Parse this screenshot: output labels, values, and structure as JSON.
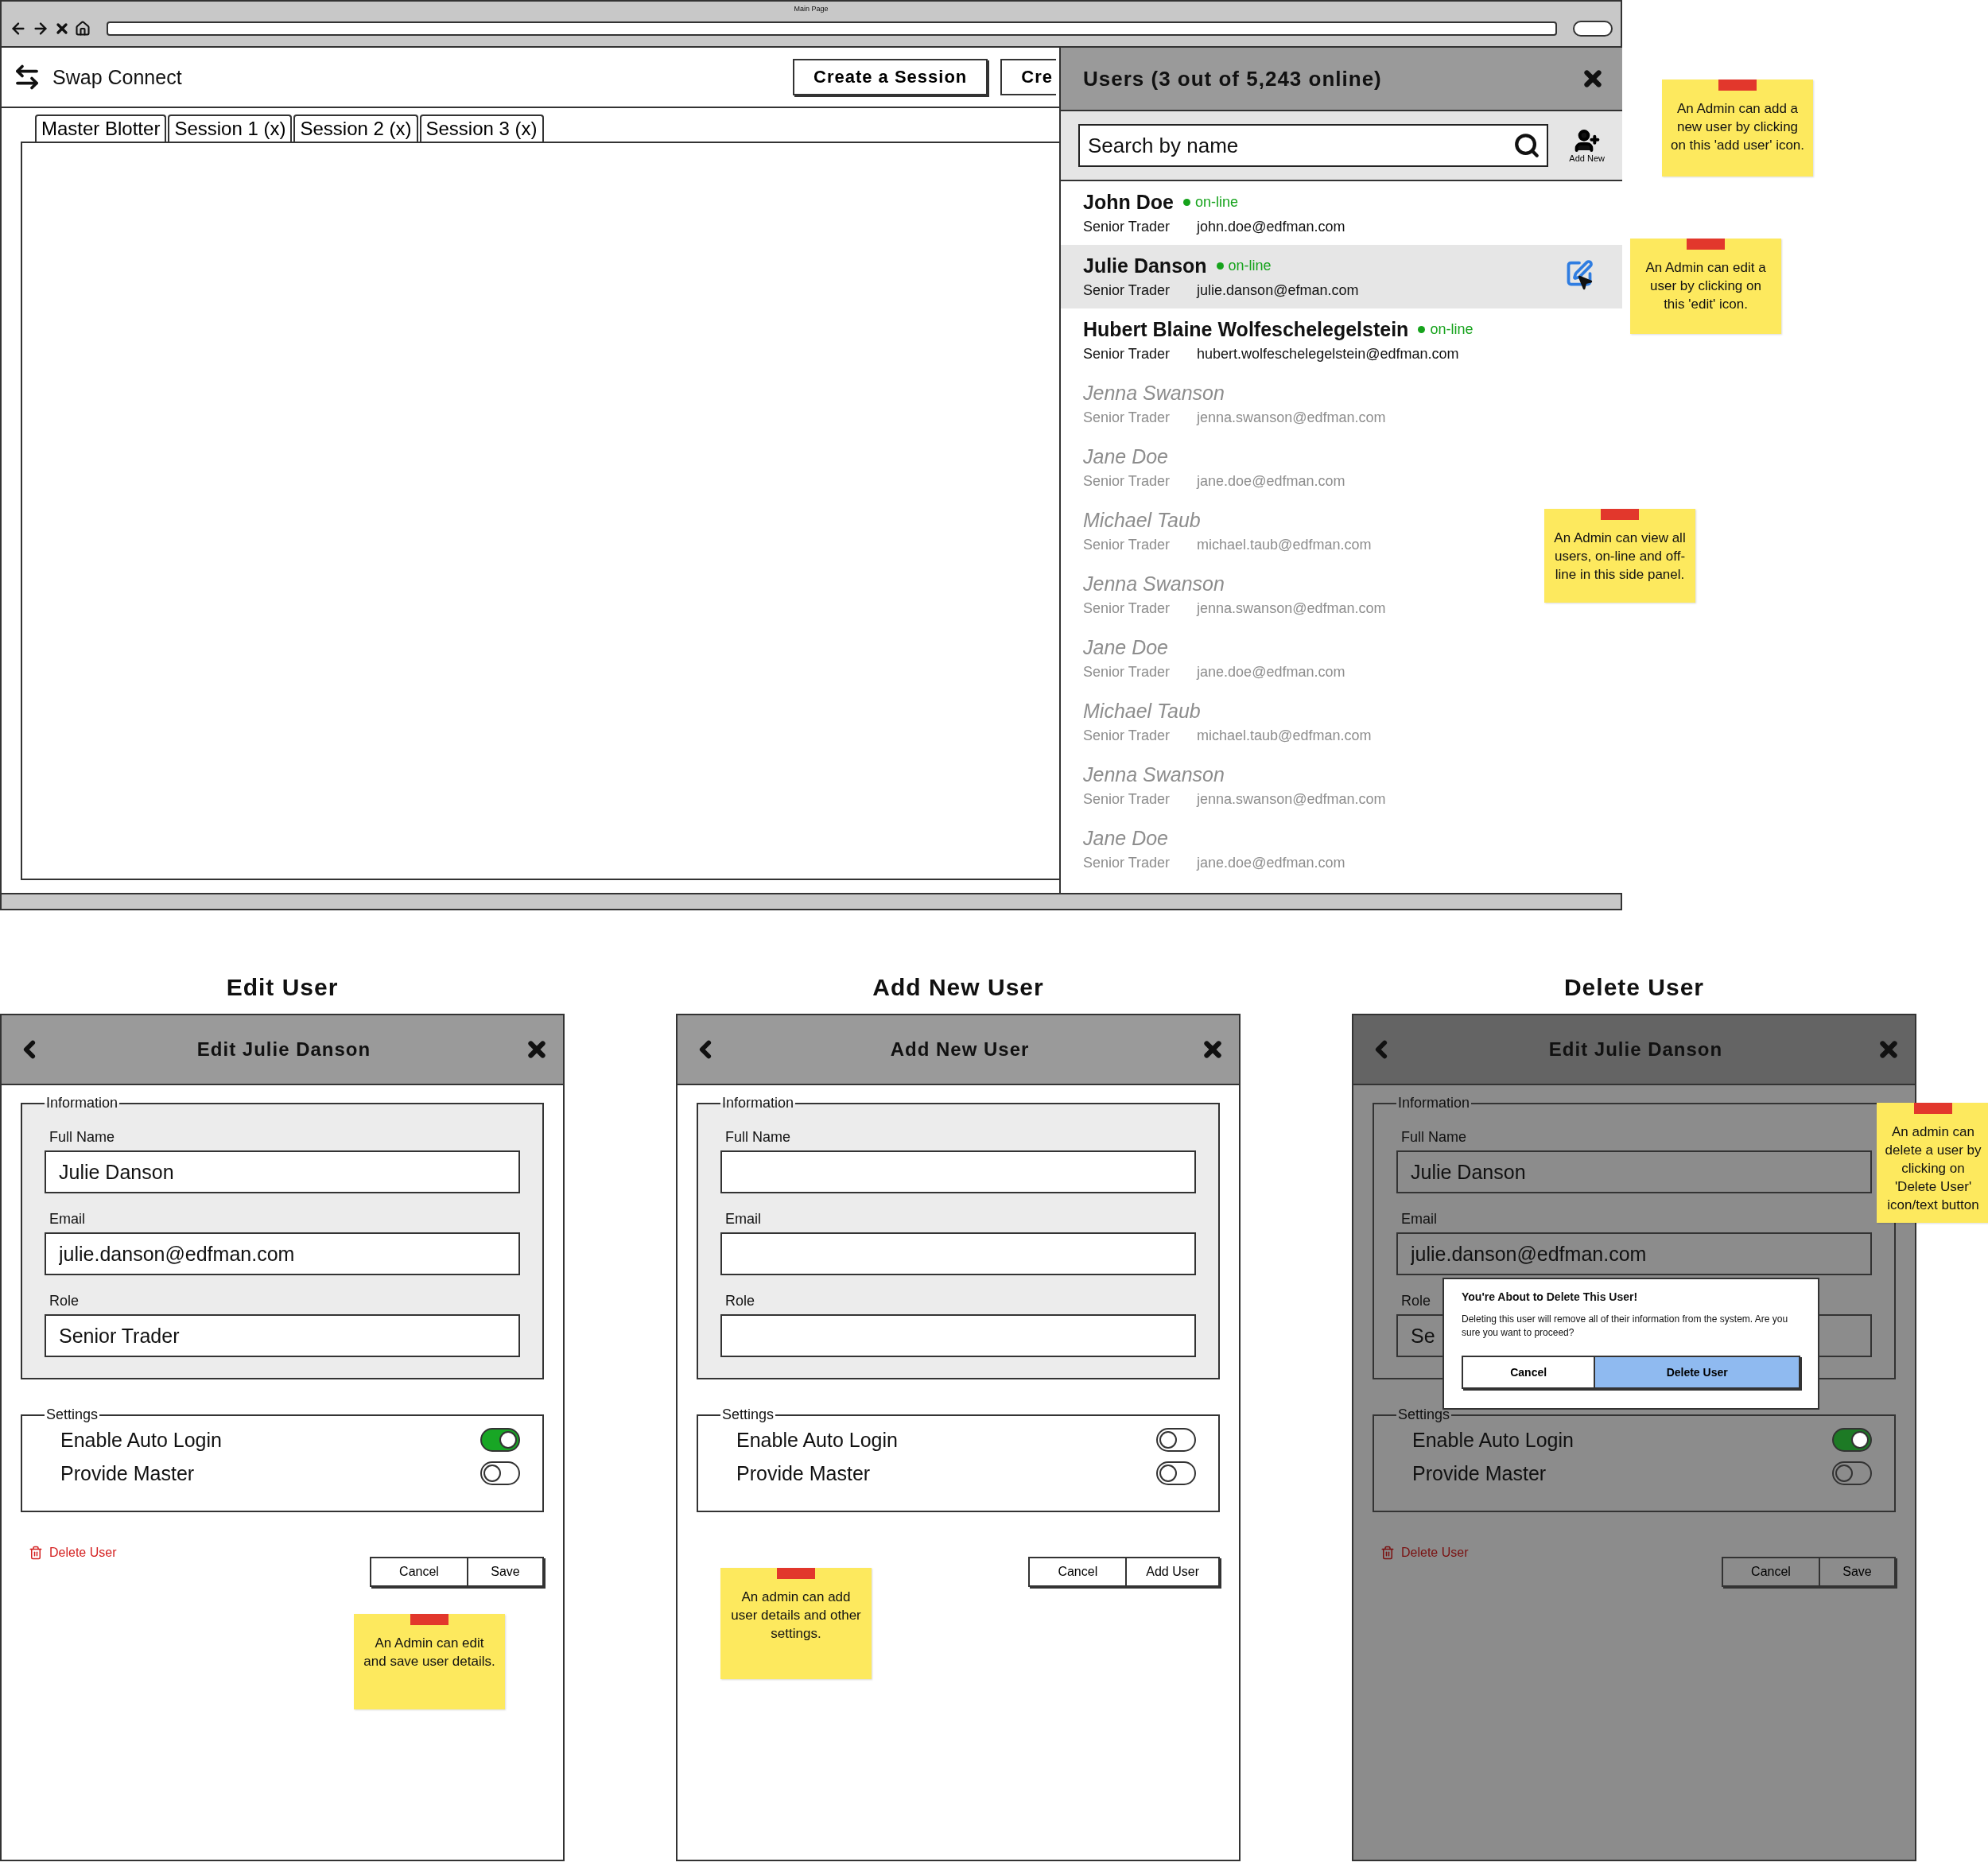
{
  "browser": {
    "title": "Main Page"
  },
  "app": {
    "name": "Swap Connect",
    "buttons": [
      "Create a Session",
      "Cre"
    ]
  },
  "tabs": [
    "Master Blotter",
    "Session 1 (x)",
    "Session 2 (x)",
    "Session 3 (x)"
  ],
  "users_panel": {
    "title": "Users (3 out of 5,243 online)",
    "search": {
      "placeholder": "Search by name"
    },
    "add_label": "Add New",
    "users": [
      {
        "name": "John Doe",
        "online": true,
        "status": "on-line",
        "role": "Senior Trader",
        "email": "john.doe@edfman.com",
        "selected": false
      },
      {
        "name": "Julie Danson",
        "online": true,
        "status": "on-line",
        "role": "Senior Trader",
        "email": "julie.danson@efman.com",
        "selected": true
      },
      {
        "name": "Hubert Blaine Wolfeschelegelstein",
        "online": true,
        "status": "on-line",
        "role": "Senior Trader",
        "email": "hubert.wolfeschelegelstein@edfman.com",
        "selected": false
      },
      {
        "name": "Jenna Swanson",
        "online": false,
        "role": "Senior Trader",
        "email": "jenna.swanson@edfman.com",
        "selected": false
      },
      {
        "name": "Jane Doe",
        "online": false,
        "role": "Senior Trader",
        "email": "jane.doe@edfman.com",
        "selected": false
      },
      {
        "name": "Michael Taub",
        "online": false,
        "role": "Senior Trader",
        "email": "michael.taub@edfman.com",
        "selected": false
      },
      {
        "name": "Jenna Swanson",
        "online": false,
        "role": "Senior Trader",
        "email": "jenna.swanson@edfman.com",
        "selected": false
      },
      {
        "name": "Jane Doe",
        "online": false,
        "role": "Senior Trader",
        "email": "jane.doe@edfman.com",
        "selected": false
      },
      {
        "name": "Michael Taub",
        "online": false,
        "role": "Senior Trader",
        "email": "michael.taub@edfman.com",
        "selected": false
      },
      {
        "name": "Jenna Swanson",
        "online": false,
        "role": "Senior Trader",
        "email": "jenna.swanson@edfman.com",
        "selected": false
      },
      {
        "name": "Jane Doe",
        "online": false,
        "role": "Senior Trader",
        "email": "jane.doe@edfman.com",
        "selected": false
      }
    ]
  },
  "notes": [
    "An Admin can add a new user by clicking on this 'add user' icon.",
    "An Admin can edit a user by clicking on this 'edit' icon.",
    "An Admin can view all users, on-line and off-line in this side panel."
  ],
  "mockups": [
    {
      "caption": "Edit User",
      "title": "Edit Julie Danson",
      "dimmed": false,
      "information_legend": "Information",
      "fields": [
        {
          "label": "Full Name",
          "value": "Julie Danson"
        },
        {
          "label": "Email",
          "value": "julie.danson@edfman.com"
        },
        {
          "label": "Role",
          "value": "Senior Trader"
        }
      ],
      "settings_legend": "Settings",
      "settings": [
        {
          "label": "Enable Auto Login",
          "on": true
        },
        {
          "label": "Provide Master",
          "on": false
        }
      ],
      "delete_link": "Delete User",
      "buttons": [
        "Cancel",
        "Save"
      ],
      "note": "An Admin can edit and save user details."
    },
    {
      "caption": "Add New User",
      "title": "Add New User",
      "dimmed": false,
      "information_legend": "Information",
      "fields": [
        {
          "label": "Full Name"
        },
        {
          "label": "Email"
        },
        {
          "label": "Role"
        }
      ],
      "settings_legend": "Settings",
      "settings": [
        {
          "label": "Enable Auto Login",
          "on": false
        },
        {
          "label": "Provide Master",
          "on": false
        }
      ],
      "buttons": [
        "Cancel",
        "Add User"
      ],
      "note": "An admin can add user details and other settings."
    },
    {
      "caption": "Delete User",
      "title": "Edit Julie Danson",
      "dimmed": true,
      "information_legend": "Information",
      "fields": [
        {
          "label": "Full Name",
          "value": "Julie Danson"
        },
        {
          "label": "Email",
          "value": "julie.danson@edfman.com"
        },
        {
          "label": "Role",
          "value": "Se"
        }
      ],
      "settings_legend": "Settings",
      "settings": [
        {
          "label": "Enable Auto Login",
          "on": true
        },
        {
          "label": "Provide Master",
          "on": false
        }
      ],
      "delete_link": "Delete User",
      "buttons": [
        "Cancel",
        "Save"
      ],
      "note": "An admin can delete a user by clicking on 'Delete User' icon/text button",
      "dialog": {
        "title": "You're About to Delete This User!",
        "message": "Deleting this user will remove all of their information from the system. Are you sure you want to proceed?",
        "buttons": [
          {
            "label": "Cancel",
            "primary": false
          },
          {
            "label": "Delete User",
            "primary": true
          }
        ]
      }
    }
  ]
}
